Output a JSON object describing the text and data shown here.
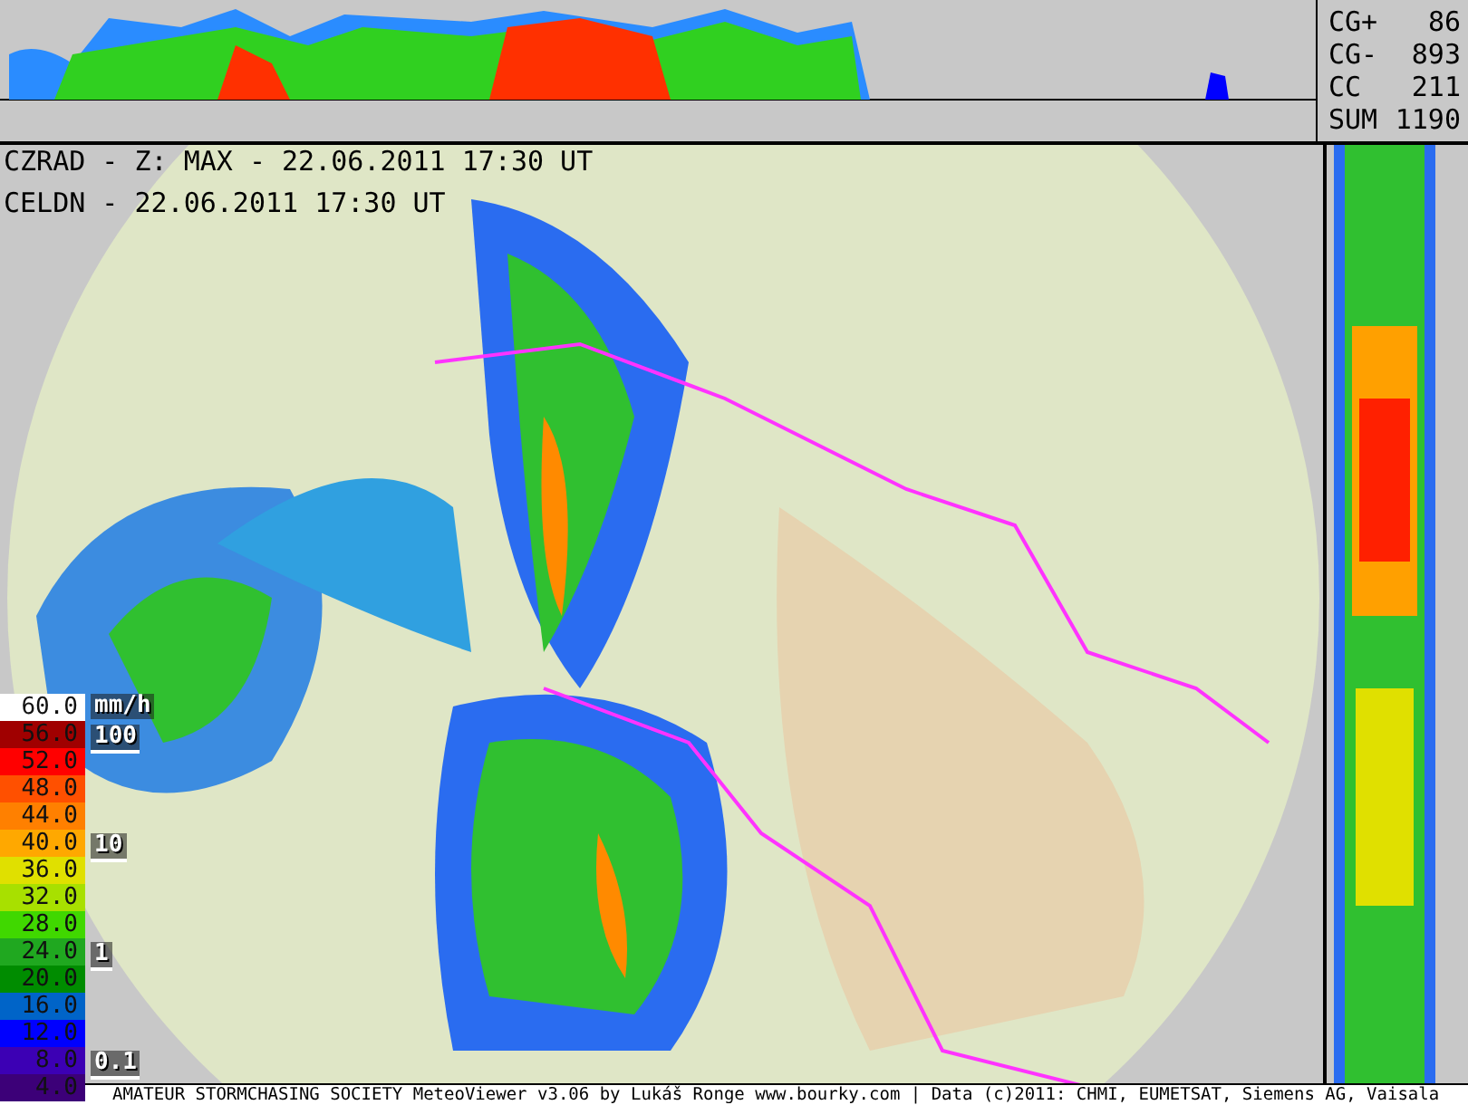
{
  "header": {
    "radar_line": "CZRAD - Z: MAX - 22.06.2011 17:30 UT",
    "lightning_line": "CELDN - 22.06.2011 17:30 UT"
  },
  "lightning_counts": [
    {
      "label": "CG+",
      "value": "86"
    },
    {
      "label": "CG-",
      "value": "893"
    },
    {
      "label": "CC",
      "value": "211"
    },
    {
      "label": "SUM",
      "value": "1190"
    }
  ],
  "legend": {
    "unit": "mm/h",
    "rain_rates": [
      "100",
      "10",
      "1",
      "0.1"
    ],
    "levels": [
      {
        "label": "60.0",
        "color": "#ffffff"
      },
      {
        "label": "56.0",
        "color": "#a00000"
      },
      {
        "label": "52.0",
        "color": "#ff0000"
      },
      {
        "label": "48.0",
        "color": "#ff5000"
      },
      {
        "label": "44.0",
        "color": "#ff8000"
      },
      {
        "label": "40.0",
        "color": "#ffa800"
      },
      {
        "label": "36.0",
        "color": "#e0e000"
      },
      {
        "label": "32.0",
        "color": "#a8e000"
      },
      {
        "label": "28.0",
        "color": "#40d800"
      },
      {
        "label": "24.0",
        "color": "#20a820"
      },
      {
        "label": "20.0",
        "color": "#008c00"
      },
      {
        "label": "16.0",
        "color": "#0064c8"
      },
      {
        "label": "12.0",
        "color": "#0000ff"
      },
      {
        "label": "8.0",
        "color": "#3c00b4"
      },
      {
        "label": "4.0",
        "color": "#3c0078"
      }
    ]
  },
  "footer": "AMATEUR STORMCHASING SOCIETY MeteoViewer v3.06 by Lukáš Ronge www.bourky.com | Data (c)2011: CHMI, EUMETSAT, Siemens AG, Vaisala"
}
